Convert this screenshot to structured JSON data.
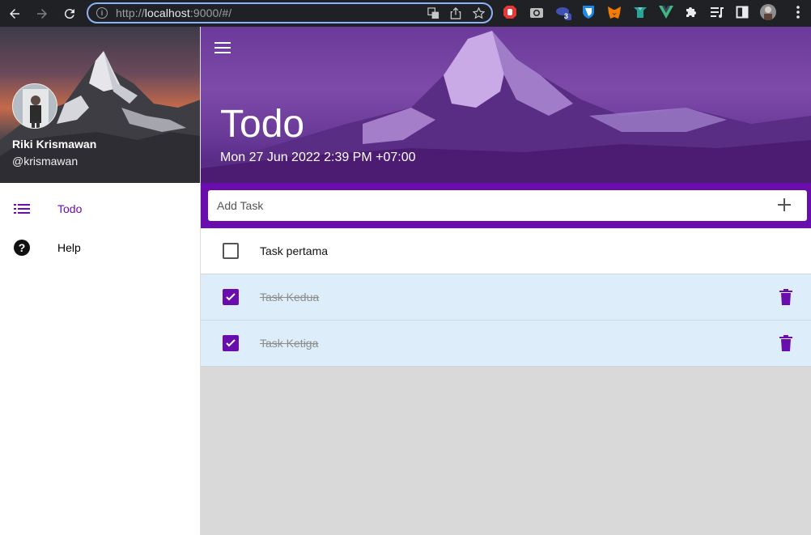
{
  "browser": {
    "url_scheme": "http://",
    "url_host": "localhost",
    "url_rest": ":9000/#/",
    "extension_badge": "3"
  },
  "drawer": {
    "user_name": "Riki Krismawan",
    "user_handle": "@krismawan",
    "items": [
      {
        "label": "Todo",
        "icon": "list-icon",
        "active": true
      },
      {
        "label": "Help",
        "icon": "help-icon",
        "active": false
      }
    ]
  },
  "header": {
    "title": "Todo",
    "date": "Mon 27 Jun 2022 2:39 PM +07:00"
  },
  "add_task": {
    "placeholder": "Add Task"
  },
  "tasks": [
    {
      "text": "Task pertama",
      "done": false
    },
    {
      "text": "Task Kedua",
      "done": true
    },
    {
      "text": "Task Ketiga",
      "done": true
    }
  ],
  "colors": {
    "primary": "#6a0dad",
    "done_row": "#ddeefa"
  }
}
